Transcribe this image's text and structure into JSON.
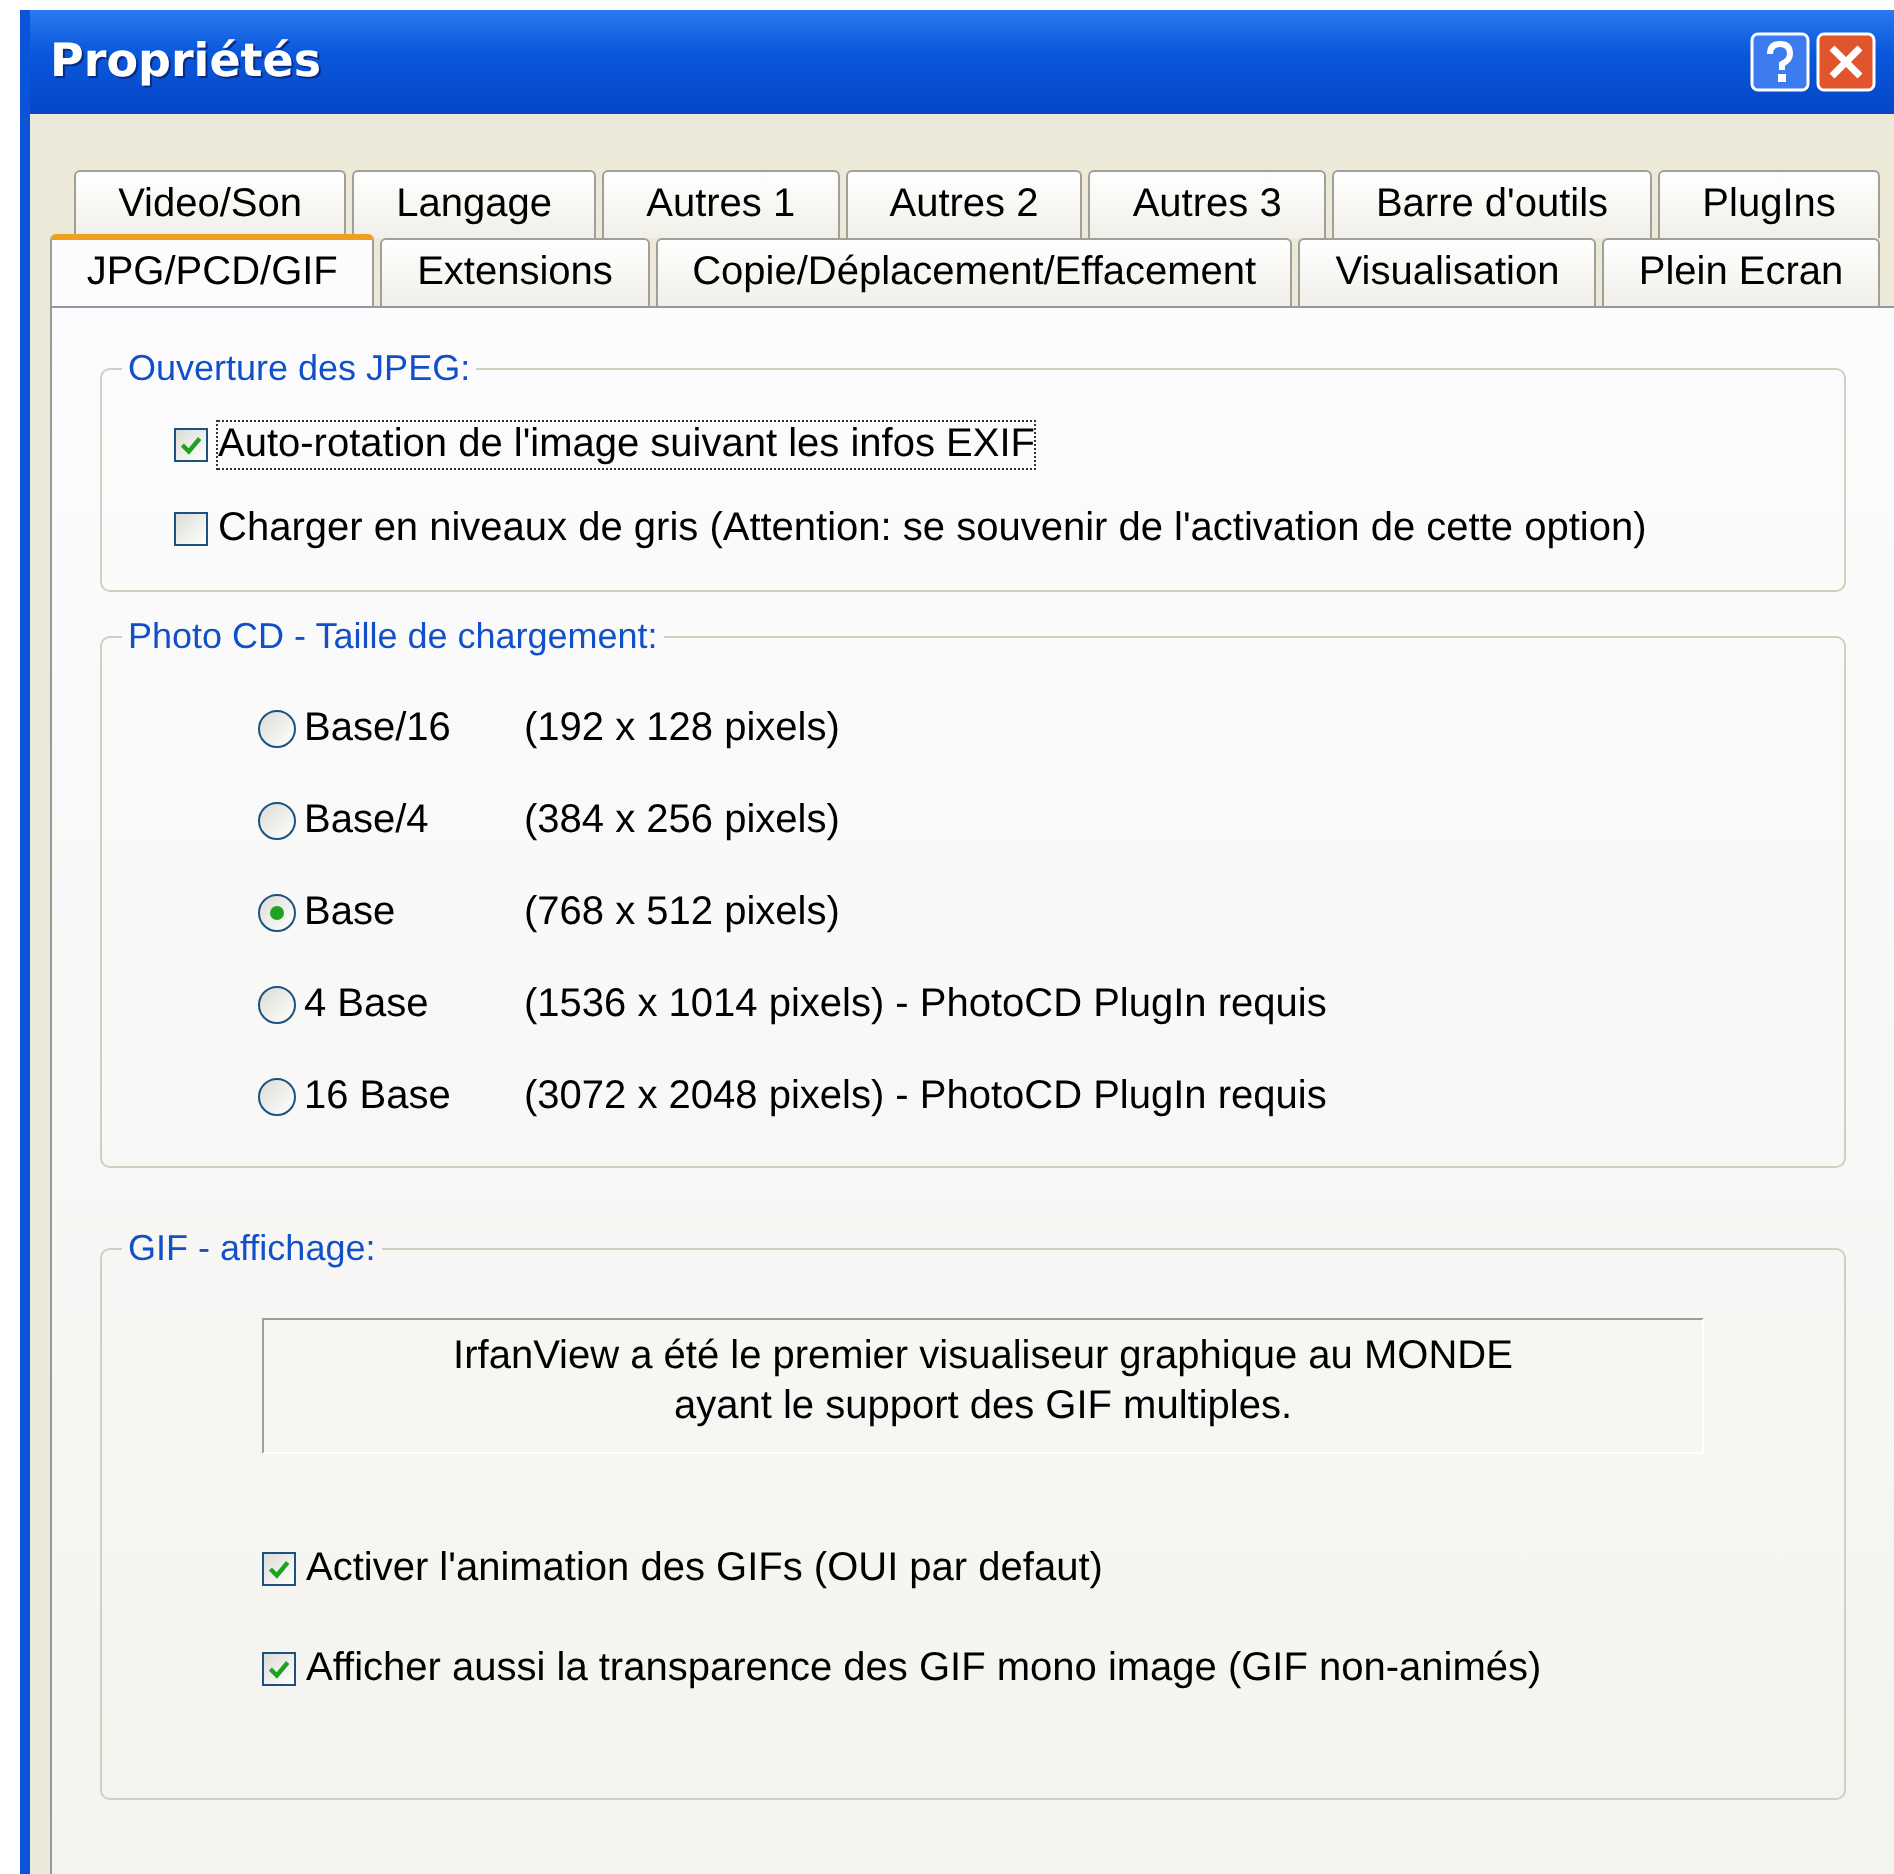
{
  "window": {
    "title": "Propriétés"
  },
  "tab_rows": [
    {
      "tabs": [
        {
          "label": "Video/Son",
          "selected": false
        },
        {
          "label": "Langage",
          "selected": false
        },
        {
          "label": "Autres 1",
          "selected": false
        },
        {
          "label": "Autres 2",
          "selected": false
        },
        {
          "label": "Autres 3",
          "selected": false
        },
        {
          "label": "Barre d'outils",
          "selected": false
        },
        {
          "label": "PlugIns",
          "selected": false
        }
      ]
    },
    {
      "tabs": [
        {
          "label": "JPG/PCD/GIF",
          "selected": true
        },
        {
          "label": "Extensions",
          "selected": false
        },
        {
          "label": "Copie/Déplacement/Effacement",
          "selected": false
        },
        {
          "label": "Visualisation",
          "selected": false
        },
        {
          "label": "Plein Ecran",
          "selected": false
        }
      ]
    }
  ],
  "jpeg_group": {
    "title": "Ouverture des JPEG:",
    "options": [
      {
        "label": "Auto-rotation de l'image suivant les infos EXIF",
        "checked": true,
        "focused": true
      },
      {
        "label": "Charger en niveaux de gris  (Attention: se souvenir de l'activation de cette option)",
        "checked": false,
        "focused": false
      }
    ]
  },
  "photocd_group": {
    "title": "Photo CD - Taille de chargement:",
    "options": [
      {
        "label": "Base/16",
        "detail": "(192 x 128 pixels)",
        "selected": false
      },
      {
        "label": "Base/4",
        "detail": "(384 x 256 pixels)",
        "selected": false
      },
      {
        "label": "Base",
        "detail": "(768 x 512 pixels)",
        "selected": true
      },
      {
        "label": "4 Base",
        "detail": "(1536 x 1014 pixels) - PhotoCD PlugIn requis",
        "selected": false
      },
      {
        "label": "16 Base",
        "detail": "(3072 x 2048 pixels) - PhotoCD PlugIn requis",
        "selected": false
      }
    ]
  },
  "gif_group": {
    "title": "GIF - affichage:",
    "info_lines": [
      "IrfanView a été le premier visualiseur graphique au MONDE",
      "ayant le support des GIF multiples."
    ],
    "options": [
      {
        "label": "Activer l'animation des GIFs (OUI par defaut)",
        "checked": true,
        "focused": false
      },
      {
        "label": "Afficher aussi la transparence des GIF mono image (GIF non-animés)",
        "checked": true,
        "focused": false
      }
    ]
  }
}
